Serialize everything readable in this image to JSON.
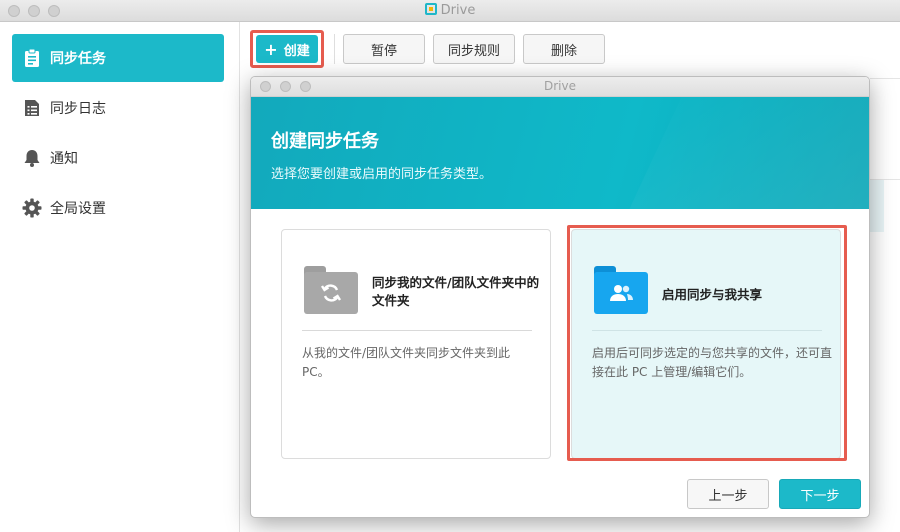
{
  "window": {
    "title": "Drive"
  },
  "sidebar": {
    "items": [
      {
        "label": "同步任务",
        "icon": "clipboard-icon",
        "active": true
      },
      {
        "label": "同步日志",
        "icon": "log-list-icon",
        "active": false
      },
      {
        "label": "通知",
        "icon": "bell-icon",
        "active": false
      },
      {
        "label": "全局设置",
        "icon": "gear-icon",
        "active": false
      }
    ]
  },
  "toolbar": {
    "create_label": "创建",
    "pause_label": "暂停",
    "rules_label": "同步规则",
    "delete_label": "删除"
  },
  "dialog": {
    "title": "Drive",
    "heading": "创建同步任务",
    "subheading": "选择您要创建或启用的同步任务类型。",
    "options": [
      {
        "title": "同步我的文件/团队文件夹中的文件夹",
        "description": "从我的文件/团队文件夹同步文件夹到此PC。",
        "icon": "sync-folder-icon",
        "selected": false
      },
      {
        "title": "启用同步与我共享",
        "description": "启用后可同步选定的与您共享的文件，还可直接在此 PC 上管理/编辑它们。",
        "icon": "shared-folder-icon",
        "selected": true
      }
    ],
    "prev_label": "上一步",
    "next_label": "下一步"
  },
  "colors": {
    "accent": "#1cb9c9",
    "highlight": "#e65c4f"
  }
}
